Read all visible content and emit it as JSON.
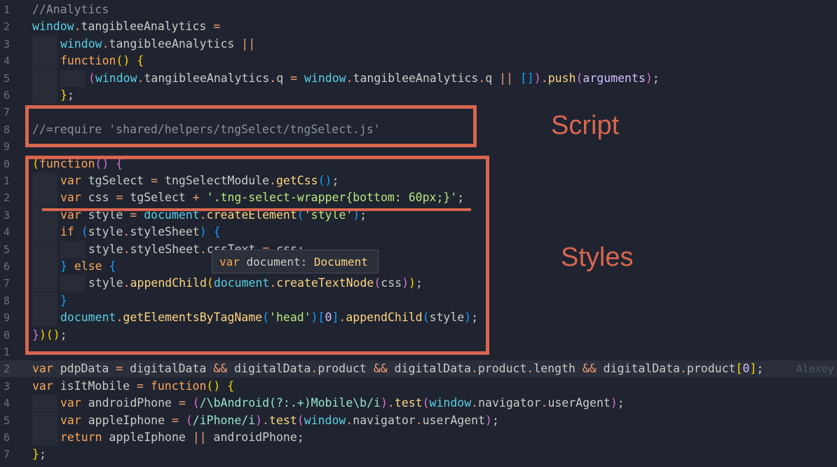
{
  "lines": [
    {
      "num": "1",
      "indent": 0,
      "tokens": [
        {
          "t": "//Analytics",
          "c": "c"
        }
      ]
    },
    {
      "num": "2",
      "indent": 0,
      "tokens": [
        {
          "t": "window",
          "c": "v"
        },
        {
          "t": ".",
          "c": "o"
        },
        {
          "t": "tangibleeAnalytics ",
          "c": "p"
        },
        {
          "t": "=",
          "c": "o"
        }
      ]
    },
    {
      "num": "3",
      "indent": 1,
      "tokens": [
        {
          "t": "window",
          "c": "v"
        },
        {
          "t": ".",
          "c": "o"
        },
        {
          "t": "tangibleeAnalytics ",
          "c": "p"
        },
        {
          "t": "||",
          "c": "o"
        }
      ]
    },
    {
      "num": "4",
      "indent": 1,
      "tokens": [
        {
          "t": "function",
          "c": "k"
        },
        {
          "t": "() ",
          "c": "b1"
        },
        {
          "t": "{",
          "c": "b1"
        }
      ]
    },
    {
      "num": "5",
      "indent": 2,
      "tokens": [
        {
          "t": "(",
          "c": "b2"
        },
        {
          "t": "window",
          "c": "v"
        },
        {
          "t": ".",
          "c": "o"
        },
        {
          "t": "tangibleeAnalytics",
          "c": "p"
        },
        {
          "t": ".",
          "c": "o"
        },
        {
          "t": "q ",
          "c": "p"
        },
        {
          "t": "=",
          "c": "o"
        },
        {
          "t": " ",
          "c": "p"
        },
        {
          "t": "window",
          "c": "v"
        },
        {
          "t": ".",
          "c": "o"
        },
        {
          "t": "tangibleeAnalytics",
          "c": "p"
        },
        {
          "t": ".",
          "c": "o"
        },
        {
          "t": "q ",
          "c": "p"
        },
        {
          "t": "||",
          "c": "o"
        },
        {
          "t": " ",
          "c": "p"
        },
        {
          "t": "[]",
          "c": "b3"
        },
        {
          "t": ")",
          "c": "b2"
        },
        {
          "t": ".",
          "c": "o"
        },
        {
          "t": "push",
          "c": "f"
        },
        {
          "t": "(",
          "c": "b2"
        },
        {
          "t": "arguments",
          "c": "n"
        },
        {
          "t": ")",
          "c": "b2"
        },
        {
          "t": ";",
          "c": "p"
        }
      ]
    },
    {
      "num": "6",
      "indent": 1,
      "tokens": [
        {
          "t": "}",
          "c": "b1"
        },
        {
          "t": ";",
          "c": "p"
        }
      ]
    },
    {
      "num": "7",
      "indent": 0,
      "tokens": []
    },
    {
      "num": "8",
      "indent": 0,
      "tokens": [
        {
          "t": "//=require 'shared/helpers/tngSelect/tngSelect.js'",
          "c": "c"
        }
      ]
    },
    {
      "num": "9",
      "indent": 0,
      "tokens": []
    },
    {
      "num": "0",
      "indent": 0,
      "tokens": [
        {
          "t": "(",
          "c": "b1"
        },
        {
          "t": "function",
          "c": "k"
        },
        {
          "t": "() ",
          "c": "b2"
        },
        {
          "t": "{",
          "c": "b2"
        }
      ]
    },
    {
      "num": "1",
      "indent": 1,
      "tokens": [
        {
          "t": "var",
          "c": "k"
        },
        {
          "t": " tgSelect ",
          "c": "p"
        },
        {
          "t": "=",
          "c": "o"
        },
        {
          "t": " tngSelectModule",
          "c": "p"
        },
        {
          "t": ".",
          "c": "o"
        },
        {
          "t": "getCss",
          "c": "f"
        },
        {
          "t": "()",
          "c": "b3"
        },
        {
          "t": ";",
          "c": "p"
        }
      ]
    },
    {
      "num": "2",
      "indent": 1,
      "tokens": [
        {
          "t": "var",
          "c": "k"
        },
        {
          "t": " css ",
          "c": "p"
        },
        {
          "t": "=",
          "c": "o"
        },
        {
          "t": " tgSelect ",
          "c": "p"
        },
        {
          "t": "+",
          "c": "o"
        },
        {
          "t": " ",
          "c": "p"
        },
        {
          "t": "'.tng-select-wrapper{bottom: 60px;}'",
          "c": "s"
        },
        {
          "t": ";",
          "c": "p"
        }
      ]
    },
    {
      "num": "3",
      "indent": 1,
      "tokens": [
        {
          "t": "var",
          "c": "k"
        },
        {
          "t": " style ",
          "c": "p"
        },
        {
          "t": "=",
          "c": "o"
        },
        {
          "t": " ",
          "c": "p"
        },
        {
          "t": "document",
          "c": "v"
        },
        {
          "t": ".",
          "c": "o"
        },
        {
          "t": "createElement",
          "c": "f"
        },
        {
          "t": "(",
          "c": "b3"
        },
        {
          "t": "'style'",
          "c": "s"
        },
        {
          "t": ")",
          "c": "b3"
        },
        {
          "t": ";",
          "c": "p"
        }
      ]
    },
    {
      "num": "4",
      "indent": 1,
      "tokens": [
        {
          "t": "if",
          "c": "k"
        },
        {
          "t": " ",
          "c": "p"
        },
        {
          "t": "(",
          "c": "b3"
        },
        {
          "t": "style",
          "c": "p"
        },
        {
          "t": ".",
          "c": "o"
        },
        {
          "t": "styleSheet",
          "c": "p"
        },
        {
          "t": ") ",
          "c": "b3"
        },
        {
          "t": "{",
          "c": "b3"
        }
      ]
    },
    {
      "num": "5",
      "indent": 2,
      "tokens": [
        {
          "t": "style",
          "c": "p"
        },
        {
          "t": ".",
          "c": "o"
        },
        {
          "t": "styleSheet",
          "c": "p"
        },
        {
          "t": ".",
          "c": "o"
        },
        {
          "t": "cssText ",
          "c": "p"
        },
        {
          "t": "=",
          "c": "o"
        },
        {
          "t": " css",
          "c": "p"
        },
        {
          "t": ";",
          "c": "p"
        }
      ]
    },
    {
      "num": "6",
      "indent": 1,
      "tokens": [
        {
          "t": "}",
          "c": "b3"
        },
        {
          "t": " ",
          "c": "p"
        },
        {
          "t": "else",
          "c": "k"
        },
        {
          "t": " ",
          "c": "p"
        },
        {
          "t": "{",
          "c": "b3"
        }
      ]
    },
    {
      "num": "7",
      "indent": 2,
      "tokens": [
        {
          "t": "style",
          "c": "p"
        },
        {
          "t": ".",
          "c": "o"
        },
        {
          "t": "appendChild",
          "c": "f"
        },
        {
          "t": "(",
          "c": "b1"
        },
        {
          "t": "document",
          "c": "v"
        },
        {
          "t": ".",
          "c": "o"
        },
        {
          "t": "createTextNode",
          "c": "f"
        },
        {
          "t": "(",
          "c": "b2"
        },
        {
          "t": "css",
          "c": "p"
        },
        {
          "t": ")",
          "c": "b2"
        },
        {
          "t": ")",
          "c": "b1"
        },
        {
          "t": ";",
          "c": "p"
        }
      ]
    },
    {
      "num": "8",
      "indent": 1,
      "tokens": [
        {
          "t": "}",
          "c": "b3"
        }
      ]
    },
    {
      "num": "9",
      "indent": 1,
      "tokens": [
        {
          "t": "document",
          "c": "v"
        },
        {
          "t": ".",
          "c": "o"
        },
        {
          "t": "getElementsByTagName",
          "c": "f"
        },
        {
          "t": "(",
          "c": "b3"
        },
        {
          "t": "'head'",
          "c": "s"
        },
        {
          "t": ")",
          "c": "b3"
        },
        {
          "t": "[",
          "c": "b3"
        },
        {
          "t": "0",
          "c": "n"
        },
        {
          "t": "]",
          "c": "b3"
        },
        {
          "t": ".",
          "c": "o"
        },
        {
          "t": "appendChild",
          "c": "f"
        },
        {
          "t": "(",
          "c": "b3"
        },
        {
          "t": "style",
          "c": "p"
        },
        {
          "t": ")",
          "c": "b3"
        },
        {
          "t": ";",
          "c": "p"
        }
      ]
    },
    {
      "num": "0",
      "indent": 0,
      "tokens": [
        {
          "t": "}",
          "c": "b2"
        },
        {
          "t": ")",
          "c": "b1"
        },
        {
          "t": "()",
          "c": "b1"
        },
        {
          "t": ";",
          "c": "p"
        }
      ]
    },
    {
      "num": "1",
      "indent": 0,
      "tokens": []
    },
    {
      "num": "2",
      "indent": 0,
      "active": true,
      "tokens": [
        {
          "t": "var",
          "c": "k"
        },
        {
          "t": " pdpData ",
          "c": "p"
        },
        {
          "t": "=",
          "c": "o"
        },
        {
          "t": " digitalData ",
          "c": "p"
        },
        {
          "t": "&&",
          "c": "o"
        },
        {
          "t": " digitalData",
          "c": "p"
        },
        {
          "t": ".",
          "c": "o"
        },
        {
          "t": "product ",
          "c": "p"
        },
        {
          "t": "&&",
          "c": "o"
        },
        {
          "t": " digitalData",
          "c": "p"
        },
        {
          "t": ".",
          "c": "o"
        },
        {
          "t": "product",
          "c": "p"
        },
        {
          "t": ".",
          "c": "o"
        },
        {
          "t": "length ",
          "c": "p"
        },
        {
          "t": "&&",
          "c": "o"
        },
        {
          "t": " digitalData",
          "c": "p"
        },
        {
          "t": ".",
          "c": "o"
        },
        {
          "t": "product",
          "c": "p"
        },
        {
          "t": "[",
          "c": "b1"
        },
        {
          "t": "0",
          "c": "n"
        },
        {
          "t": "]",
          "c": "b1"
        },
        {
          "t": ";",
          "c": "p"
        }
      ]
    },
    {
      "num": "3",
      "indent": 0,
      "tokens": [
        {
          "t": "var",
          "c": "k"
        },
        {
          "t": " isItMobile ",
          "c": "p"
        },
        {
          "t": "=",
          "c": "o"
        },
        {
          "t": " ",
          "c": "p"
        },
        {
          "t": "function",
          "c": "k"
        },
        {
          "t": "() ",
          "c": "b1"
        },
        {
          "t": "{",
          "c": "b1"
        }
      ]
    },
    {
      "num": "4",
      "indent": 1,
      "tokens": [
        {
          "t": "var",
          "c": "k"
        },
        {
          "t": " androidPhone ",
          "c": "p"
        },
        {
          "t": "=",
          "c": "o"
        },
        {
          "t": " ",
          "c": "p"
        },
        {
          "t": "(",
          "c": "b2"
        },
        {
          "t": "/\\bAndroid(?:.+)Mobile\\b/i",
          "c": "r"
        },
        {
          "t": ")",
          "c": "b2"
        },
        {
          "t": ".",
          "c": "o"
        },
        {
          "t": "test",
          "c": "f"
        },
        {
          "t": "(",
          "c": "b2"
        },
        {
          "t": "window",
          "c": "v"
        },
        {
          "t": ".",
          "c": "o"
        },
        {
          "t": "navigator",
          "c": "p"
        },
        {
          "t": ".",
          "c": "o"
        },
        {
          "t": "userAgent",
          "c": "p"
        },
        {
          "t": ")",
          "c": "b2"
        },
        {
          "t": ";",
          "c": "p"
        }
      ]
    },
    {
      "num": "5",
      "indent": 1,
      "tokens": [
        {
          "t": "var",
          "c": "k"
        },
        {
          "t": " appleIphone ",
          "c": "p"
        },
        {
          "t": "=",
          "c": "o"
        },
        {
          "t": " ",
          "c": "p"
        },
        {
          "t": "(",
          "c": "b2"
        },
        {
          "t": "/iPhone/i",
          "c": "r"
        },
        {
          "t": ")",
          "c": "b2"
        },
        {
          "t": ".",
          "c": "o"
        },
        {
          "t": "test",
          "c": "f"
        },
        {
          "t": "(",
          "c": "b2"
        },
        {
          "t": "window",
          "c": "v"
        },
        {
          "t": ".",
          "c": "o"
        },
        {
          "t": "navigator",
          "c": "p"
        },
        {
          "t": ".",
          "c": "o"
        },
        {
          "t": "userAgent",
          "c": "p"
        },
        {
          "t": ")",
          "c": "b2"
        },
        {
          "t": ";",
          "c": "p"
        }
      ]
    },
    {
      "num": "6",
      "indent": 1,
      "tokens": [
        {
          "t": "return",
          "c": "k"
        },
        {
          "t": " appleIphone ",
          "c": "p"
        },
        {
          "t": "||",
          "c": "o"
        },
        {
          "t": " androidPhone",
          "c": "p"
        },
        {
          "t": ";",
          "c": "p"
        }
      ]
    },
    {
      "num": "7",
      "indent": 0,
      "tokens": [
        {
          "t": "}",
          "c": "b1"
        },
        {
          "t": ";",
          "c": "p"
        }
      ]
    }
  ],
  "annotations": {
    "script_label": "Script",
    "styles_label": "Styles",
    "color": "#d8664f"
  },
  "tooltip": {
    "keyword": "var",
    "name": " document: ",
    "type": "Document"
  },
  "blame": "Alexey"
}
